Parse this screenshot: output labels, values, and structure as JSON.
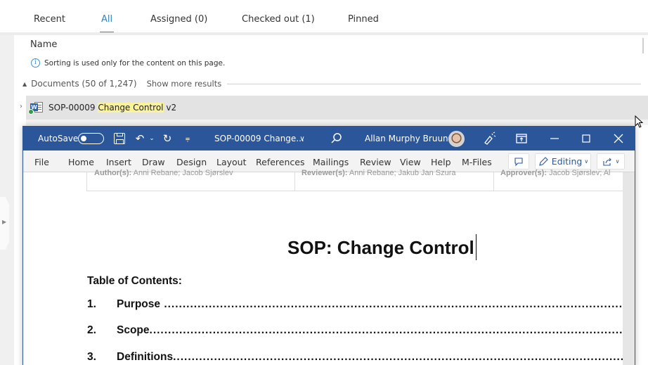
{
  "mfiles": {
    "tabs": [
      {
        "label": "Recent",
        "active": false
      },
      {
        "label": "All",
        "active": true
      },
      {
        "label": "Assigned (0)",
        "active": false
      },
      {
        "label": "Checked out (1)",
        "active": false
      },
      {
        "label": "Pinned",
        "active": false
      }
    ],
    "accent_color": "#2f84c4",
    "column_header": "Name",
    "info_icon": "info-icon",
    "sorting_note": "Sorting is used only for the content on this page.",
    "group": {
      "label": "Documents (50 of 1,247)",
      "show_more": "Show more results",
      "expanded_icon": "triangle-up-icon"
    },
    "document_row": {
      "id": "SOP-00009",
      "name_highlight": "Change Control",
      "version": "v2",
      "icon": "word-document-icon",
      "status_icon": "checked-out-check-icon"
    }
  },
  "word": {
    "title_bar": {
      "autosave_label": "AutoSave",
      "autosave_state": "Off",
      "document_title": "SOP-00009 Change...",
      "user_name": "Allan Murphy Bruun",
      "brand_color": "#2b579a"
    },
    "ribbon_tabs": [
      "File",
      "Home",
      "Insert",
      "Draw",
      "Design",
      "Layout",
      "References",
      "Mailings",
      "Review",
      "View",
      "Help",
      "M-Files"
    ],
    "editing_label": "Editing",
    "document": {
      "header_cells": [
        {
          "label": "Author(s):",
          "value": "Anni Rebane; Jacob Sjørslev"
        },
        {
          "label": "Reviewer(s):",
          "value": "Anni Rebane; Jakub Jan Szura"
        },
        {
          "label": "Approver(s):",
          "value": "Jacob Sjørslev; Al"
        }
      ],
      "heading": "SOP: Change Control",
      "toc_title": "Table of Contents:",
      "toc": [
        {
          "num": "1.",
          "title": "Purpose"
        },
        {
          "num": "2.",
          "title": "Scope"
        },
        {
          "num": "3.",
          "title": "Definitions"
        }
      ]
    }
  }
}
